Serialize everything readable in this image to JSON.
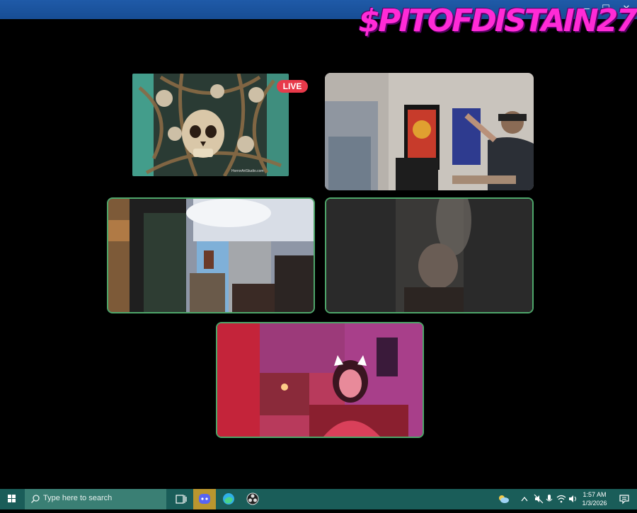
{
  "window": {
    "minimize_glyph": "—",
    "maximize_glyph": "☐",
    "close_glyph": "✕"
  },
  "overlay": {
    "streamer_name": "$PITOFDISTAIN27"
  },
  "participants": [
    {
      "id": "skull-live",
      "badge": "LIVE",
      "watermark": "HorrorArtStudio.com",
      "speaking": false
    },
    {
      "id": "bearded-man",
      "speaking": false
    },
    {
      "id": "dark-room",
      "speaking": true
    },
    {
      "id": "low-light",
      "speaking": true
    },
    {
      "id": "cat-ears",
      "speaking": true
    }
  ],
  "taskbar": {
    "search_placeholder": "Type here to search",
    "apps": [
      "task-view-icon",
      "discord-icon",
      "edge-icon",
      "obs-icon"
    ],
    "clock_time": "1:57 AM",
    "clock_date": "1/3/2026"
  },
  "colors": {
    "titlebar": "#1f5aa8",
    "active_border": "#4ea66a",
    "taskbar": "#1a5d59",
    "live_badge": "#e8394a",
    "streamer_name": "#ff2bd6"
  }
}
